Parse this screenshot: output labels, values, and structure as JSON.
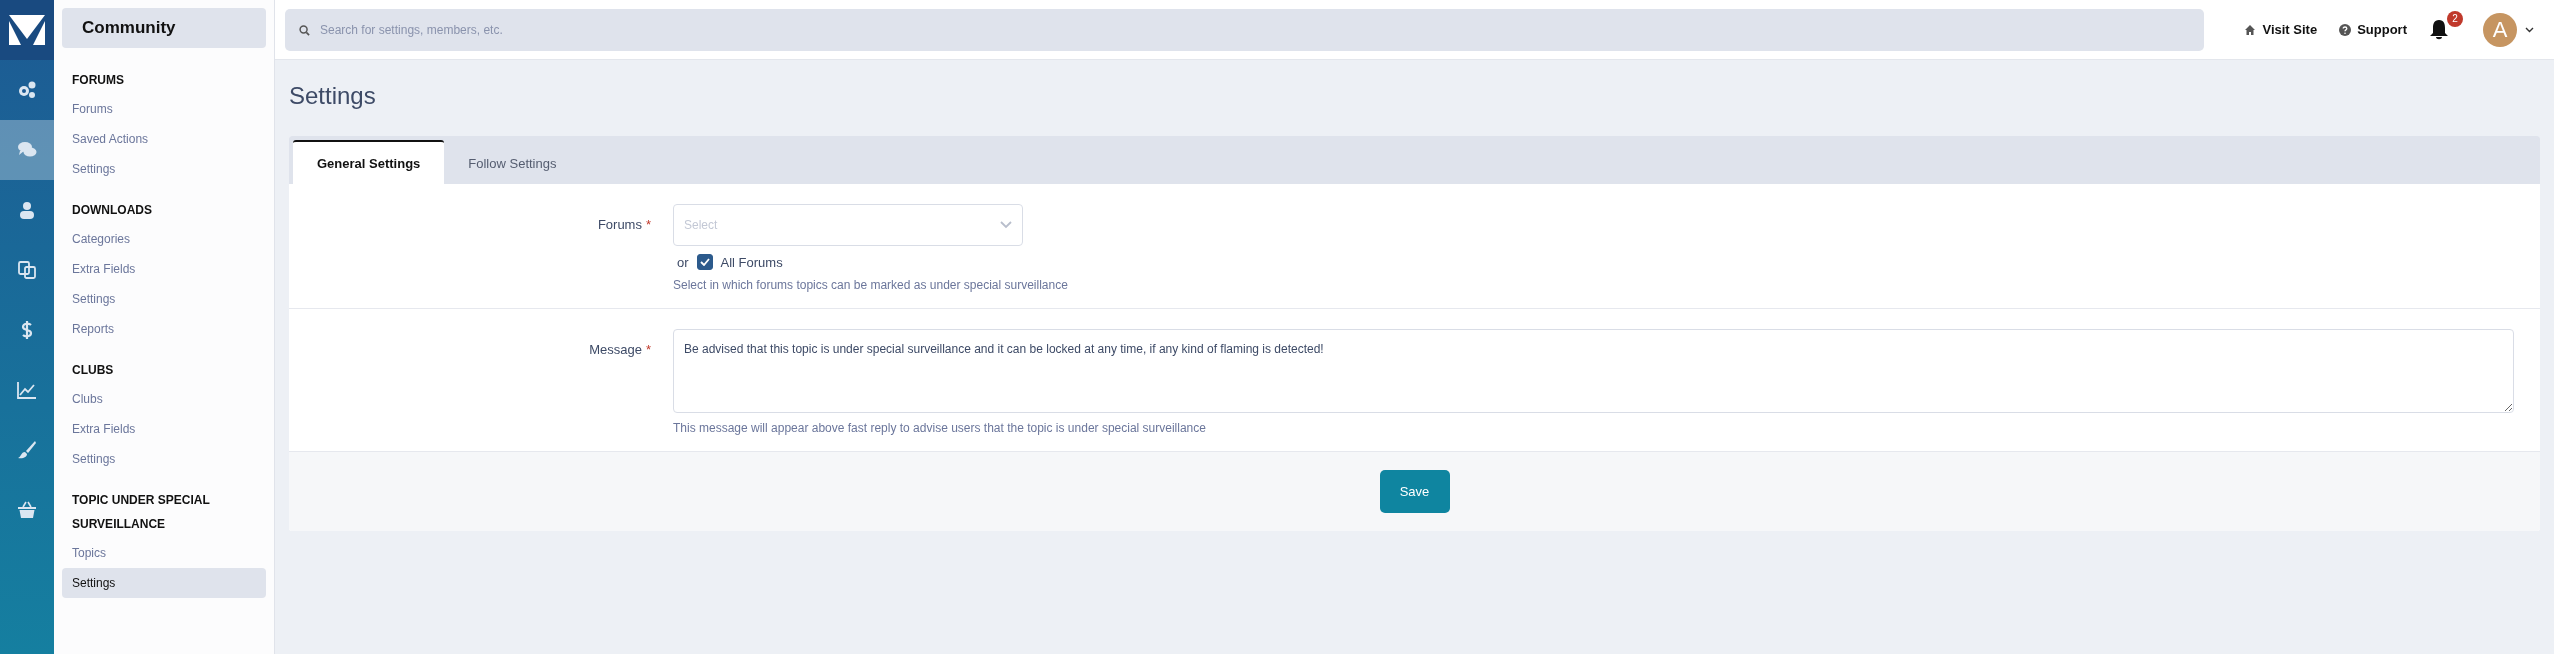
{
  "rail": {
    "items": [
      {
        "kind": "gears",
        "selected": false
      },
      {
        "kind": "chat",
        "selected": true
      },
      {
        "kind": "user",
        "selected": false
      },
      {
        "kind": "copy",
        "selected": false
      },
      {
        "kind": "dollar",
        "selected": false
      },
      {
        "kind": "chart",
        "selected": false
      },
      {
        "kind": "brush",
        "selected": false
      },
      {
        "kind": "basket",
        "selected": false
      }
    ]
  },
  "sidebar": {
    "title": "Community",
    "sections": [
      {
        "heading": "FORUMS",
        "items": [
          {
            "label": "Forums",
            "selected": false
          },
          {
            "label": "Saved Actions",
            "selected": false
          },
          {
            "label": "Settings",
            "selected": false
          }
        ]
      },
      {
        "heading": "DOWNLOADS",
        "items": [
          {
            "label": "Categories",
            "selected": false
          },
          {
            "label": "Extra Fields",
            "selected": false
          },
          {
            "label": "Settings",
            "selected": false
          },
          {
            "label": "Reports",
            "selected": false
          }
        ]
      },
      {
        "heading": "CLUBS",
        "items": [
          {
            "label": "Clubs",
            "selected": false
          },
          {
            "label": "Extra Fields",
            "selected": false
          },
          {
            "label": "Settings",
            "selected": false
          }
        ]
      },
      {
        "heading": "TOPIC UNDER SPECIAL SURVEILLANCE",
        "items": [
          {
            "label": "Topics",
            "selected": false
          },
          {
            "label": "Settings",
            "selected": true
          }
        ]
      }
    ]
  },
  "topbar": {
    "search": {
      "placeholder": "Search for settings, members, etc."
    },
    "links": [
      {
        "kind": "home",
        "label": "Visit Site"
      },
      {
        "kind": "help",
        "label": "Support"
      }
    ],
    "notifications": "2",
    "avatar": "A"
  },
  "page": {
    "title": "Settings",
    "tabs": [
      {
        "label": "General Settings",
        "selected": true
      },
      {
        "label": "Follow Settings",
        "selected": false
      }
    ],
    "fields": [
      {
        "kind": "select",
        "label": "Forums",
        "required_mark": "*",
        "placeholder": "Select",
        "or": "or",
        "checkbox": {
          "label": "All Forums",
          "checked": true
        },
        "help": "Select in which forums topics can be marked as under special surveillance"
      },
      {
        "kind": "textarea",
        "label": "Message",
        "required_mark": "*",
        "value": "Be advised that this topic is under special surveillance and it can be locked at any time, if any kind of flaming is detected!",
        "help": "This message will appear above fast reply to advise users that the topic is under special surveillance"
      }
    ],
    "save": "Save"
  }
}
